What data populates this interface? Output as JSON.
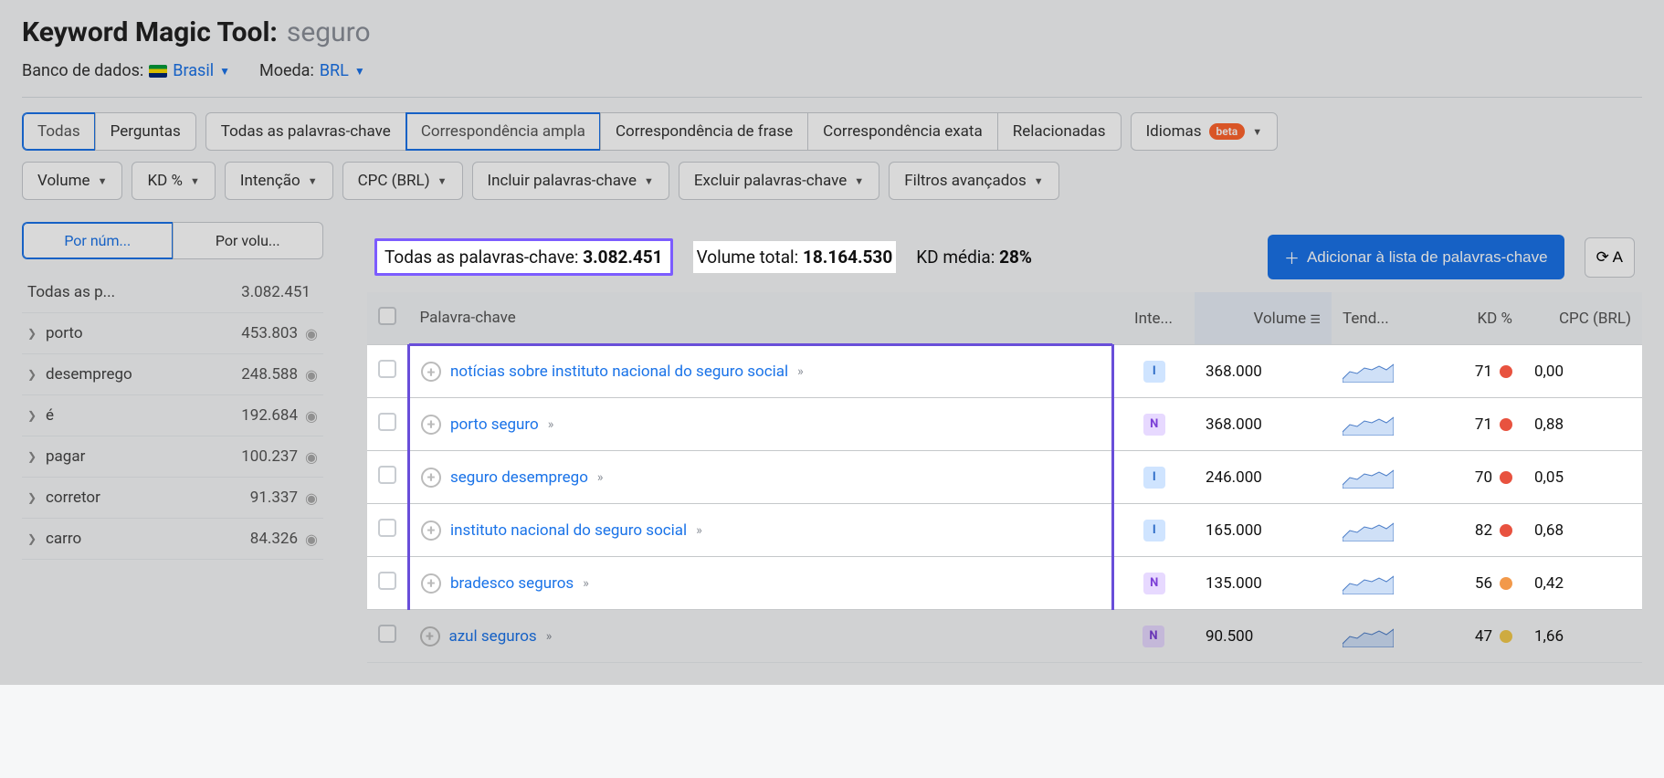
{
  "header": {
    "title": "Keyword Magic Tool:",
    "keyword": "seguro",
    "db_label": "Banco de dados:",
    "db_value": "Brasil",
    "currency_label": "Moeda:",
    "currency_value": "BRL"
  },
  "tabs_primary": {
    "all": "Todas",
    "questions": "Perguntas"
  },
  "tabs_match": {
    "all_kw": "Todas as palavras-chave",
    "broad": "Correspondência ampla",
    "phrase": "Correspondência de frase",
    "exact": "Correspondência exata",
    "related": "Relacionadas"
  },
  "lang_btn": {
    "label": "Idiomas",
    "badge": "beta"
  },
  "filters": {
    "volume": "Volume",
    "kd": "KD %",
    "intent": "Intenção",
    "cpc": "CPC (BRL)",
    "include": "Incluir palavras-chave",
    "exclude": "Excluir palavras-chave",
    "advanced": "Filtros avançados"
  },
  "sidebar_tabs": {
    "by_num": "Por núm...",
    "by_vol": "Por volu..."
  },
  "sidebar_header": {
    "label": "Todas as p...",
    "count": "3.082.451"
  },
  "sidebar_items": [
    {
      "label": "porto",
      "count": "453.803"
    },
    {
      "label": "desemprego",
      "count": "248.588"
    },
    {
      "label": "é",
      "count": "192.684"
    },
    {
      "label": "pagar",
      "count": "100.237"
    },
    {
      "label": "corretor",
      "count": "91.337"
    },
    {
      "label": "carro",
      "count": "84.326"
    }
  ],
  "summary": {
    "kw_label": "Todas as palavras-chave:",
    "kw_value": "3.082.451",
    "vol_label": "Volume total:",
    "vol_value": "18.164.530",
    "kd_label": "KD média:",
    "kd_value": "28%",
    "add_btn": "Adicionar à lista de palavras-chave",
    "refresh_partial": "A"
  },
  "columns": {
    "kw": "Palavra-chave",
    "intent": "Inte...",
    "volume": "Volume",
    "trend": "Tend...",
    "kd": "KD %",
    "cpc": "CPC (BRL)"
  },
  "rows": [
    {
      "kw": "notícias sobre instituto nacional do seguro social",
      "intent": "I",
      "volume": "368.000",
      "kd": "71",
      "kd_c": "red",
      "cpc": "0,00",
      "hi": true
    },
    {
      "kw": "porto seguro",
      "intent": "N",
      "volume": "368.000",
      "kd": "71",
      "kd_c": "red",
      "cpc": "0,88",
      "hi": true
    },
    {
      "kw": "seguro desemprego",
      "intent": "I",
      "volume": "246.000",
      "kd": "70",
      "kd_c": "red",
      "cpc": "0,05",
      "hi": true
    },
    {
      "kw": "instituto nacional do seguro social",
      "intent": "I",
      "volume": "165.000",
      "kd": "82",
      "kd_c": "red",
      "cpc": "0,68",
      "hi": true
    },
    {
      "kw": "bradesco seguros",
      "intent": "N",
      "volume": "135.000",
      "kd": "56",
      "kd_c": "orange",
      "cpc": "0,42",
      "hi": true
    },
    {
      "kw": "azul seguros",
      "intent": "N",
      "volume": "90.500",
      "kd": "47",
      "kd_c": "yellow",
      "cpc": "1,66",
      "hi": false
    }
  ]
}
